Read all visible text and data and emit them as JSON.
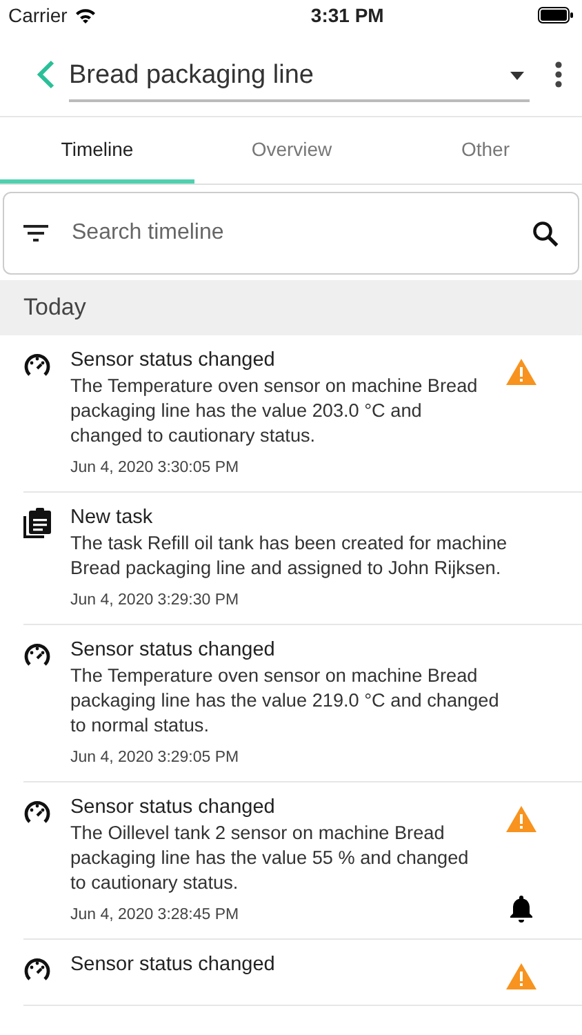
{
  "status_bar": {
    "carrier": "Carrier",
    "time": "3:31 PM"
  },
  "header": {
    "title": "Bread packaging line"
  },
  "tabs": [
    {
      "label": "Timeline",
      "selected": true
    },
    {
      "label": "Overview",
      "selected": false
    },
    {
      "label": "Other",
      "selected": false
    }
  ],
  "search": {
    "placeholder": "Search timeline"
  },
  "section": "Today",
  "entries": [
    {
      "kind": "sensor",
      "title": "Sensor status changed",
      "text": "The Temperature oven sensor on machine Bread packaging line has the value 203.0 °C and changed to cautionary status.",
      "time": "Jun 4, 2020 3:30:05 PM",
      "warning": true,
      "bell": false
    },
    {
      "kind": "task",
      "title": "New task",
      "text": "The task Refill oil tank has been created for machine Bread packaging line and assigned to John Rijksen.",
      "time": "Jun 4, 2020 3:29:30 PM",
      "warning": false,
      "bell": false
    },
    {
      "kind": "sensor",
      "title": "Sensor status changed",
      "text": "The Temperature oven sensor on machine Bread packaging line has the value 219.0 °C and changed to normal status.",
      "time": "Jun 4, 2020 3:29:05 PM",
      "warning": false,
      "bell": false
    },
    {
      "kind": "sensor",
      "title": "Sensor status changed",
      "text": "The Oillevel tank 2 sensor on machine Bread packaging line has the value 55 % and changed to cautionary status.",
      "time": "Jun 4, 2020 3:28:45 PM",
      "warning": true,
      "bell": true
    },
    {
      "kind": "sensor",
      "title": "Sensor status changed",
      "warning": true,
      "bell": false
    }
  ]
}
